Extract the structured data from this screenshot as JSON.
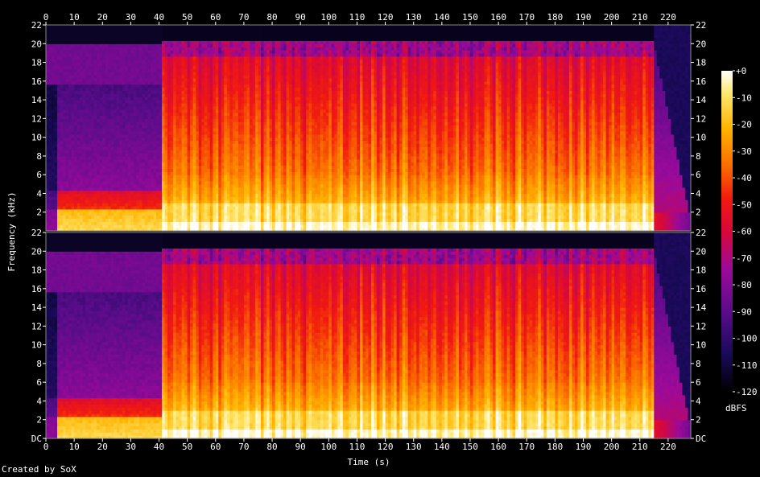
{
  "chart_data": {
    "type": "heatmap",
    "title": "",
    "xlabel": "Time (s)",
    "ylabel": "Frequency (kHz)",
    "xlim": [
      0,
      228
    ],
    "ylim": [
      0,
      22
    ],
    "x_ticks": [
      "0",
      "10",
      "20",
      "30",
      "40",
      "50",
      "60",
      "70",
      "80",
      "90",
      "100",
      "110",
      "120",
      "130",
      "140",
      "150",
      "160",
      "170",
      "180",
      "190",
      "200",
      "210",
      "220"
    ],
    "y_ticks": [
      "DC",
      "2",
      "4",
      "6",
      "8",
      "10",
      "12",
      "14",
      "16",
      "18",
      "20",
      "22"
    ],
    "channels": 2,
    "segments": [
      {
        "start": 0,
        "end": 41,
        "description": "quiet intro, energy below ~4 kHz, cutoff near 15-16 kHz"
      },
      {
        "start": 41,
        "end": 215,
        "description": "full band content up to ~20 kHz"
      },
      {
        "start": 215,
        "end": 228,
        "description": "fade out"
      }
    ],
    "colorbar": {
      "unit": "dBFS",
      "ticks": [
        "+0",
        "-10",
        "-20",
        "-30",
        "-40",
        "-50",
        "-60",
        "-70",
        "-80",
        "-90",
        "-100",
        "-110",
        "-120"
      ],
      "range": [
        -120,
        0
      ],
      "colors": [
        "#000000",
        "#1a0a5a",
        "#5a0c8a",
        "#9a0a9a",
        "#d8083a",
        "#f01a10",
        "#fa6a00",
        "#ffb400",
        "#ffe870",
        "#ffffff"
      ]
    },
    "credit": "Created by SoX"
  }
}
